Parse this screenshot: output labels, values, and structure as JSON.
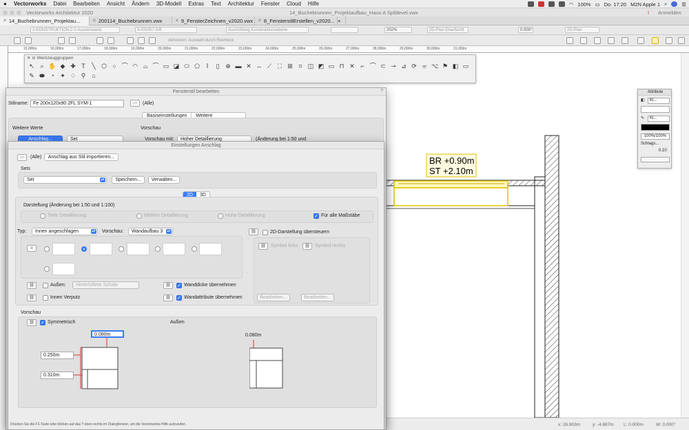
{
  "menubar": {
    "app": "Vectorworks",
    "items": [
      "Datei",
      "Bearbeiten",
      "Ansicht",
      "Ändern",
      "3D-Modell",
      "Extras",
      "Text",
      "Architektur",
      "Fenster",
      "Cloud",
      "Hilfe"
    ],
    "battery": "100%",
    "clock": "Do. 17:20",
    "user": "M2N Apple 1"
  },
  "window": {
    "app_title": "Vectorworks Architektur 2020",
    "doc_title": "14_Buchebrunnen_Projektaufbau_Haus A Splitlevel.vwx",
    "signin": "Anmelden"
  },
  "tabs": [
    {
      "label": "14_Buchebrunnen_Projektau..."
    },
    {
      "label": "200114_Buchebrunnen.vwx"
    },
    {
      "label": "9_FensterZeichnen_v2020.vwx"
    },
    {
      "label": "8_FensterstilErstellen_v2020..."
    }
  ],
  "toolbar": {
    "class_field": "2-KONSTRUKTION-2-1-Aussenwand",
    "layer_field": "A-EG057-GR",
    "wall_field": "Ausrichtung Konstruktionsebene",
    "zoom": "202%",
    "view": "2D-Plan Draufsicht",
    "rotation": "0.000°",
    "plan": "2D-Plan",
    "mode_hint": "Aktivieren: Auswahl durch Rechteck"
  },
  "ruler_labels": [
    "15,000m",
    "16,000m",
    "17,000m",
    "18,000m",
    "19,000m",
    "20,000m",
    "21,000m",
    "22,000m",
    "23,000m",
    "24,000m",
    "25,000m",
    "26,000m",
    "27,000m",
    "28,000m",
    "29,000m",
    "30,000m",
    "31,000m"
  ],
  "tool_palette": {
    "title": "Werkzeuggruppen"
  },
  "attr_palette": {
    "title": "Attribute",
    "fill_label": "Kl...",
    "pen_label": "Kl...",
    "opacity": "100%/100%",
    "shadow": "Schlags...",
    "thickness": "0.10"
  },
  "canvas": {
    "label_br": "BR +0.90m",
    "label_st": "ST +2.10m"
  },
  "status": {
    "x": "x: 26.903m",
    "y": "y: -4.687m",
    "l": "L: 0.000m",
    "w": "W: 0.000°"
  },
  "dlg_style": {
    "title": "Fensterstil bearbeiten",
    "stilname_label": "Stilname:",
    "stilname_value": "Fe 200x120x90 2FL SYM-1",
    "alle": "(Alle)",
    "tab_basis": "Basiseinstellungen",
    "tab_weitere": "Weitere Einstellungen",
    "weitere_werte": "Weitere Werte",
    "btn_anschlag": "Anschlag...",
    "set_value": "Set",
    "vorschau_label": "Vorschau",
    "vorschau_mit": "Vorschau mit:",
    "detail_value": "Hoher Detaillierung",
    "aenderung": "(Änderung bei 1:50 und"
  },
  "dlg_anschlag": {
    "title": "Einstellungen Anschlag",
    "alle": "(Alle)",
    "import_btn": "Anschlag aus Stil importieren...",
    "sets_label": "Sets",
    "set_value": "Set",
    "btn_save": "Speichern...",
    "btn_manage": "Verwalten...",
    "seg_2d": "2D",
    "seg_3d": "3D",
    "darstellung": "Darstellung (Änderung bei 1:50 und 1:100)",
    "opt_tiefe": "Tiefe Detaillierung",
    "opt_mittel": "Mittlere Detaillierung",
    "opt_hoch": "Hohe Detaillierung",
    "opt_alle": "Für alle Maßstäbe",
    "typ_label": "Typ:",
    "typ_value": "Innen angeschlagen",
    "vorschau_label": "Vorschau:",
    "vorschau_value": "Wandaufbau 3",
    "override_2d": "2D-Darstellung übersteuern",
    "symbol_links": "Symbol links",
    "symbol_rechts": "Symbol rechts",
    "aussen_label": "Außen:",
    "aussen_value": "Hinterlüftete Schale",
    "innen_verputz": "Innen Verputz",
    "wanddicke": "Wanddicke übernehmen",
    "wandattribute": "Wandattribute übernehmen",
    "btn_bearbeiten1": "Bearbeiten...",
    "btn_bearbeiten2": "Bearbeiten...",
    "vorschau_section": "Vorschau",
    "symmetrisch": "Symmetrisch",
    "aussen_title": "Außen",
    "dim_top": "0.080m",
    "dim_top_right": "0.080m",
    "dim_mid": "0.250m",
    "dim_bottom": "0.310m",
    "footer": "Drücken Sie die F1-Taste oder klicken auf das ? oben rechts im Dialogfenster, um die Vectorworks-Hilfe aufzurufen."
  }
}
